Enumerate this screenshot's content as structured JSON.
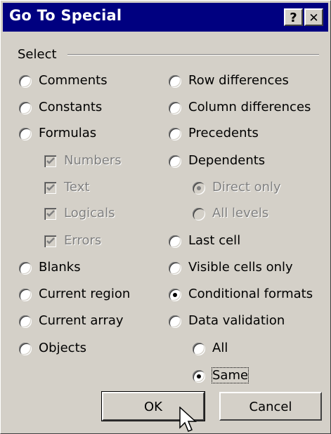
{
  "window": {
    "title": "Go To Special",
    "help_label": "?",
    "close_label": "✕"
  },
  "group": {
    "label": "Select"
  },
  "left_options": [
    {
      "label": "Comments",
      "mnemonic": "C",
      "state": "unselected"
    },
    {
      "label": "Constants",
      "mnemonic": "o",
      "state": "unselected"
    },
    {
      "label": "Formulas",
      "mnemonic": "F",
      "state": "unselected"
    },
    {
      "label": "Numbers",
      "checked": true,
      "disabled": true
    },
    {
      "label": "Text",
      "checked": true,
      "disabled": true
    },
    {
      "label": "Logicals",
      "checked": true,
      "disabled": true
    },
    {
      "label": "Errors",
      "checked": true,
      "disabled": true
    },
    {
      "label": "Blanks",
      "mnemonic": "k",
      "state": "unselected"
    },
    {
      "label": "Current region",
      "mnemonic": "r",
      "state": "unselected"
    },
    {
      "label": "Current array",
      "mnemonic": "a",
      "state": "unselected"
    },
    {
      "label": "Objects",
      "mnemonic": "b",
      "state": "unselected"
    }
  ],
  "right_options": [
    {
      "label": "Row differences",
      "mnemonic": "w",
      "state": "unselected"
    },
    {
      "label": "Column differences",
      "mnemonic": "m",
      "state": "unselected"
    },
    {
      "label": "Precedents",
      "mnemonic": "P",
      "state": "unselected"
    },
    {
      "label": "Dependents",
      "mnemonic": "D",
      "state": "unselected"
    },
    {
      "label": "Direct only",
      "state": "selected",
      "disabled": true
    },
    {
      "label": "All levels",
      "state": "unselected",
      "disabled": true
    },
    {
      "label": "Last cell",
      "mnemonic": "s",
      "state": "unselected"
    },
    {
      "label": "Visible cells only",
      "mnemonic": "y",
      "state": "unselected"
    },
    {
      "label": "Conditional formats",
      "mnemonic": "t",
      "state": "selected"
    },
    {
      "label": "Data validation",
      "mnemonic": "v",
      "state": "unselected"
    },
    {
      "label": "All",
      "mnemonic": "l",
      "state": "unselected"
    },
    {
      "label": "Same",
      "mnemonic": "e",
      "state": "selected",
      "focused": true
    }
  ],
  "buttons": {
    "ok_label": "OK",
    "cancel_label": "Cancel"
  },
  "colors": {
    "face": "#d4d0c8",
    "titlebar": "#000080",
    "disabled_text": "#808080"
  }
}
